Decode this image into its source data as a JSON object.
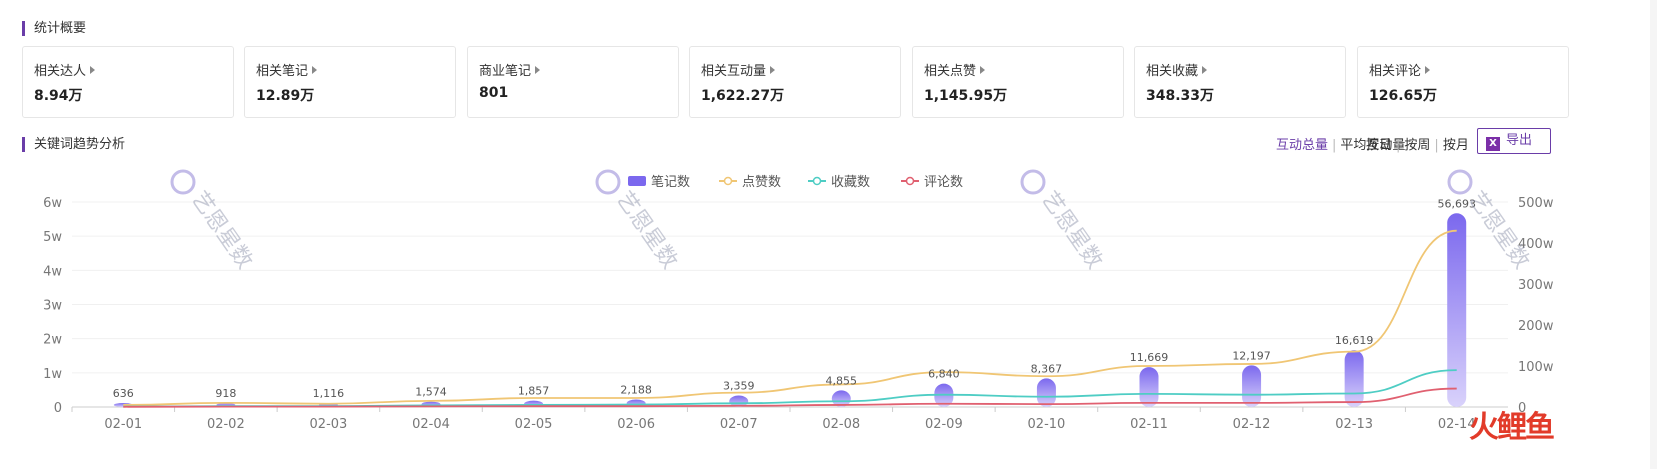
{
  "overview": {
    "title": "统计概要",
    "cards": [
      {
        "label": "相关达人",
        "value": "8.94万"
      },
      {
        "label": "相关笔记",
        "value": "12.89万"
      },
      {
        "label": "商业笔记",
        "value": "801"
      },
      {
        "label": "相关互动量",
        "value": "1,622.27万"
      },
      {
        "label": "相关点赞",
        "value": "1,145.95万"
      },
      {
        "label": "相关收藏",
        "value": "348.33万"
      },
      {
        "label": "相关评论",
        "value": "126.65万"
      }
    ]
  },
  "trend": {
    "title": "关键词趋势分析",
    "metric_options": [
      "互动总量",
      "平均互动量"
    ],
    "active_metric": "互动总量",
    "period_options": [
      "按日",
      "按周",
      "按月"
    ],
    "export_label": "导出",
    "watermark": "艺恩星数"
  },
  "colors": {
    "accent": "#6a3da8",
    "notes_bar": "#7b68ee",
    "likes": "#f0c674",
    "collects": "#4ecdc4",
    "comments": "#e06070"
  },
  "chart_data": {
    "type": "bar",
    "categories": [
      "02-01",
      "02-02",
      "02-03",
      "02-04",
      "02-05",
      "02-06",
      "02-07",
      "02-08",
      "02-09",
      "02-10",
      "02-11",
      "02-12",
      "02-13",
      "02-14"
    ],
    "series": [
      {
        "name": "笔记数",
        "type": "bar",
        "axis": "left",
        "values": [
          636,
          918,
          1116,
          1574,
          1857,
          2188,
          3359,
          4855,
          6840,
          8367,
          11669,
          12197,
          16619,
          56693
        ],
        "labels": [
          "636",
          "918",
          "1,116",
          "1,574",
          "1,857",
          "2,188",
          "3,359",
          "4,855",
          "6,840",
          "8,367",
          "11,669",
          "12,197",
          "16,619",
          "56,693"
        ]
      },
      {
        "name": "点赞数",
        "type": "line",
        "axis": "right",
        "values": [
          5,
          10,
          8,
          15,
          22,
          22,
          35,
          55,
          85,
          75,
          100,
          105,
          135,
          430
        ]
      },
      {
        "name": "收藏数",
        "type": "line",
        "axis": "right",
        "values": [
          1,
          2,
          2,
          4,
          5,
          6,
          9,
          14,
          30,
          25,
          32,
          30,
          33,
          90
        ]
      },
      {
        "name": "评论数",
        "type": "line",
        "axis": "right",
        "values": [
          0.5,
          1,
          1,
          1.5,
          2,
          2,
          3,
          5,
          8,
          7,
          10,
          10,
          12,
          45
        ]
      }
    ],
    "left_axis": {
      "ticks": [
        "0",
        "1w",
        "2w",
        "3w",
        "4w",
        "5w",
        "6w"
      ],
      "ylim": [
        0,
        60000
      ]
    },
    "right_axis": {
      "ticks": [
        "0",
        "100w",
        "200w",
        "300w",
        "400w",
        "500w"
      ],
      "ylim": [
        0,
        500
      ]
    },
    "legend": "top-center",
    "grid": true
  },
  "corner_logo": {
    "text": "火鲤鱼"
  }
}
